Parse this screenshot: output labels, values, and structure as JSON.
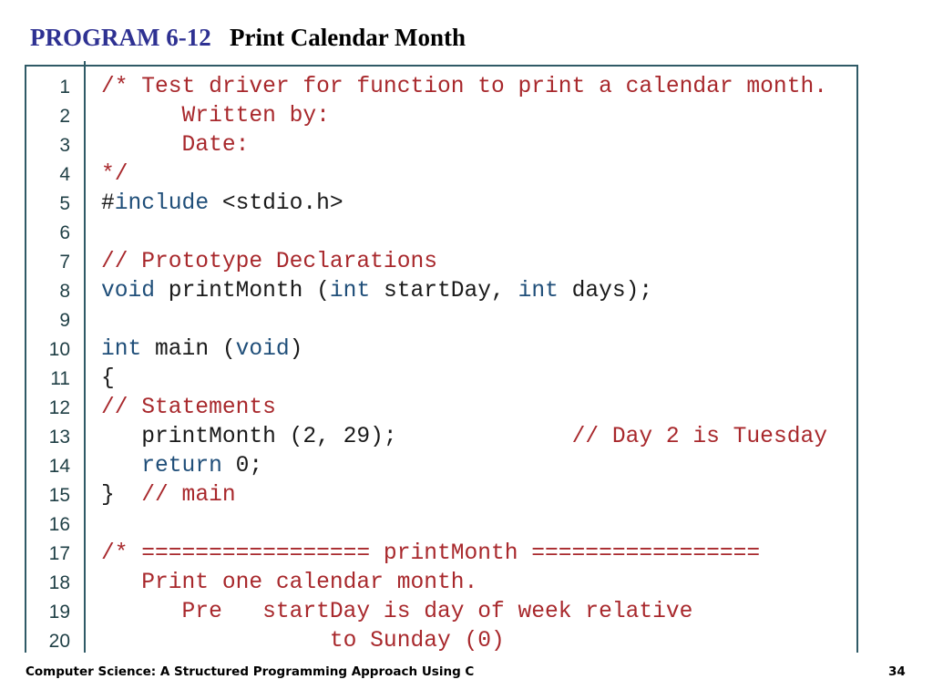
{
  "title": {
    "program_label": "PROGRAM 6-12",
    "program_name": "Print Calendar Month"
  },
  "colors": {
    "program_label": "#2e3192",
    "comment": "#a8282c",
    "keyword": "#1f4e79",
    "plain": "#1a1a1a",
    "border": "#2f5a66"
  },
  "code_lines": [
    {
      "num": "1",
      "tokens": [
        {
          "t": "/* Test driver for function to print a calendar month.",
          "k": "comment"
        }
      ]
    },
    {
      "num": "2",
      "tokens": [
        {
          "t": "      Written by:",
          "k": "comment"
        }
      ]
    },
    {
      "num": "3",
      "tokens": [
        {
          "t": "      Date:",
          "k": "comment"
        }
      ]
    },
    {
      "num": "4",
      "tokens": [
        {
          "t": "*/",
          "k": "comment"
        }
      ]
    },
    {
      "num": "5",
      "tokens": [
        {
          "t": "#",
          "k": "plain"
        },
        {
          "t": "include",
          "k": "keyword"
        },
        {
          "t": " <stdio.h>",
          "k": "plain"
        }
      ]
    },
    {
      "num": "6",
      "tokens": []
    },
    {
      "num": "7",
      "tokens": [
        {
          "t": "// Prototype Declarations",
          "k": "comment"
        }
      ]
    },
    {
      "num": "8",
      "tokens": [
        {
          "t": "void",
          "k": "keyword"
        },
        {
          "t": " printMonth (",
          "k": "plain"
        },
        {
          "t": "int",
          "k": "keyword"
        },
        {
          "t": " startDay, ",
          "k": "plain"
        },
        {
          "t": "int",
          "k": "keyword"
        },
        {
          "t": " days);",
          "k": "plain"
        }
      ]
    },
    {
      "num": "9",
      "tokens": []
    },
    {
      "num": "10",
      "tokens": [
        {
          "t": "int",
          "k": "keyword"
        },
        {
          "t": " main (",
          "k": "plain"
        },
        {
          "t": "void",
          "k": "keyword"
        },
        {
          "t": ")",
          "k": "plain"
        }
      ]
    },
    {
      "num": "11",
      "tokens": [
        {
          "t": "{",
          "k": "plain"
        }
      ]
    },
    {
      "num": "12",
      "tokens": [
        {
          "t": "// Statements",
          "k": "comment"
        }
      ]
    },
    {
      "num": "13",
      "tokens": [
        {
          "t": "   printMonth (2, 29);             ",
          "k": "plain"
        },
        {
          "t": "// Day 2 is Tuesday",
          "k": "comment"
        }
      ]
    },
    {
      "num": "14",
      "tokens": [
        {
          "t": "   ",
          "k": "plain"
        },
        {
          "t": "return",
          "k": "keyword"
        },
        {
          "t": " 0;",
          "k": "plain"
        }
      ]
    },
    {
      "num": "15",
      "tokens": [
        {
          "t": "}  ",
          "k": "plain"
        },
        {
          "t": "// main",
          "k": "comment"
        }
      ]
    },
    {
      "num": "16",
      "tokens": []
    },
    {
      "num": "17",
      "tokens": [
        {
          "t": "/* ================= printMonth =================",
          "k": "comment"
        }
      ]
    },
    {
      "num": "18",
      "tokens": [
        {
          "t": "   Print one calendar month.",
          "k": "comment"
        }
      ]
    },
    {
      "num": "19",
      "tokens": [
        {
          "t": "      Pre   startDay is day of week relative",
          "k": "comment"
        }
      ]
    },
    {
      "num": "20",
      "tokens": [
        {
          "t": "                 to Sunday (0)",
          "k": "comment"
        }
      ]
    }
  ],
  "footer": {
    "book_title": "Computer Science: A Structured Programming Approach Using C",
    "page_number": "34"
  }
}
